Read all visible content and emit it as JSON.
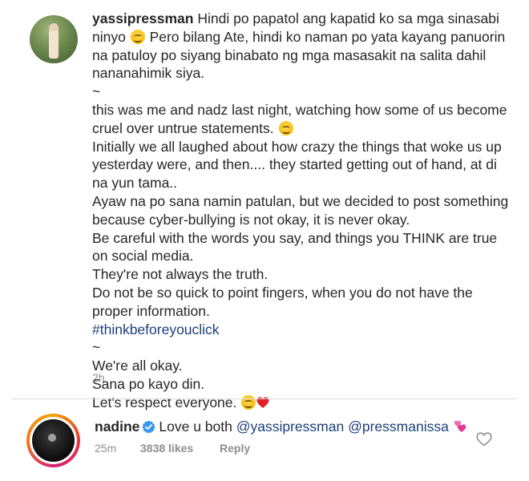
{
  "post": {
    "username": "yassipressman",
    "paragraphs": [
      " Hindi po papatol ang kapatid ko sa mga sinasabi ninyo ",
      " Pero bilang Ate, hindi ko naman po yata kayang panuorin na patuloy po siyang binabato ng mga masasakit na salita dahil nananahimik siya.",
      "~",
      "this was me and nadz last night, watching how some of us become cruel over untrue statements. ",
      "Initially we all laughed about how crazy the things that woke us up yesterday were, and then.... they started getting out of hand, at di na yun tama..",
      "Ayaw na po sana namin patulan, but we decided to post something because cyber-bullying is not okay, it is never okay.",
      "Be careful with the words you say, and things you THINK are true on social media.",
      "They're not always the truth.",
      "Do not be so quick to point fingers, when you do not have the proper information.",
      "#thinkbeforeyouclick",
      "~",
      "We're all okay.",
      "Sana po kayo din.",
      "Let's respect everyone. "
    ],
    "time": "2h",
    "icons": [
      "smiling-emoji",
      "red-heart-emoji"
    ]
  },
  "reply": {
    "username": "nadine",
    "text_prefix": "Love u both ",
    "mention1": "@yassipressman",
    "mention2": "@pressmanissa",
    "time": "25m",
    "likes": "3838 likes",
    "reply_label": "Reply",
    "icons": [
      "verified-badge-icon",
      "two-hearts-emoji",
      "heart-outline-icon"
    ]
  },
  "colors": {
    "text": "#262626",
    "muted": "#8e8e8e",
    "link": "#1c3f7a",
    "verified": "#3897f0",
    "divider": "#dbdbdb"
  }
}
